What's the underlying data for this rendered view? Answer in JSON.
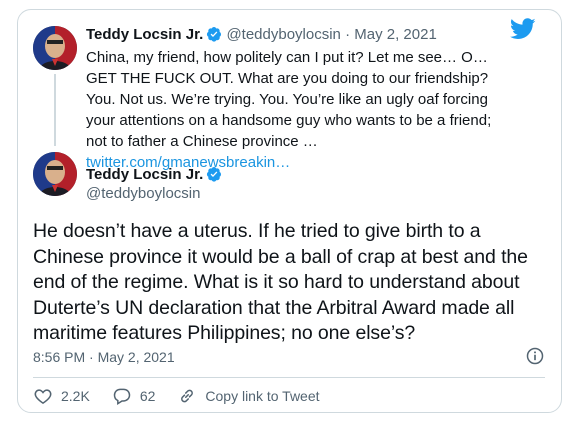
{
  "quoted_tweet": {
    "display_name": "Teddy Locsin Jr.",
    "handle": "@teddyboylocsin",
    "separator": "·",
    "date": "May 2, 2021",
    "text": "China, my friend, how politely can I put it? Let me see… O…GET THE FUCK OUT. What are you doing to our friendship? You. Not us. We’re trying. You. You’re like an ugly oaf forcing your attentions on a handsome guy who wants to be a friend; not to father a Chinese province … ",
    "link_text": "twitter.com/gmanewsbreakin…"
  },
  "main_tweet": {
    "display_name": "Teddy Locsin Jr.",
    "handle": "@teddyboylocsin",
    "text": "He doesn’t have a uterus. If he tried to give birth to a Chinese province it would be a ball of crap at best and the end of the regime. What is it so hard to understand about Duterte’s UN declaration that the Arbitral Award made all maritime features Philippines; no one else’s?",
    "timestamp": "8:56 PM · May 2, 2021"
  },
  "actions": {
    "likes": "2.2K",
    "replies": "62",
    "copy_link_label": "Copy link to Tweet"
  },
  "colors": {
    "brand_blue": "#1d9bf0",
    "link_blue": "#1b95e0",
    "muted": "#536471",
    "border": "#cfd9de",
    "like_red": "#e0245e"
  },
  "icons": [
    "twitter-bird-icon",
    "verified-badge-icon",
    "info-icon",
    "heart-icon",
    "reply-icon",
    "link-icon"
  ]
}
